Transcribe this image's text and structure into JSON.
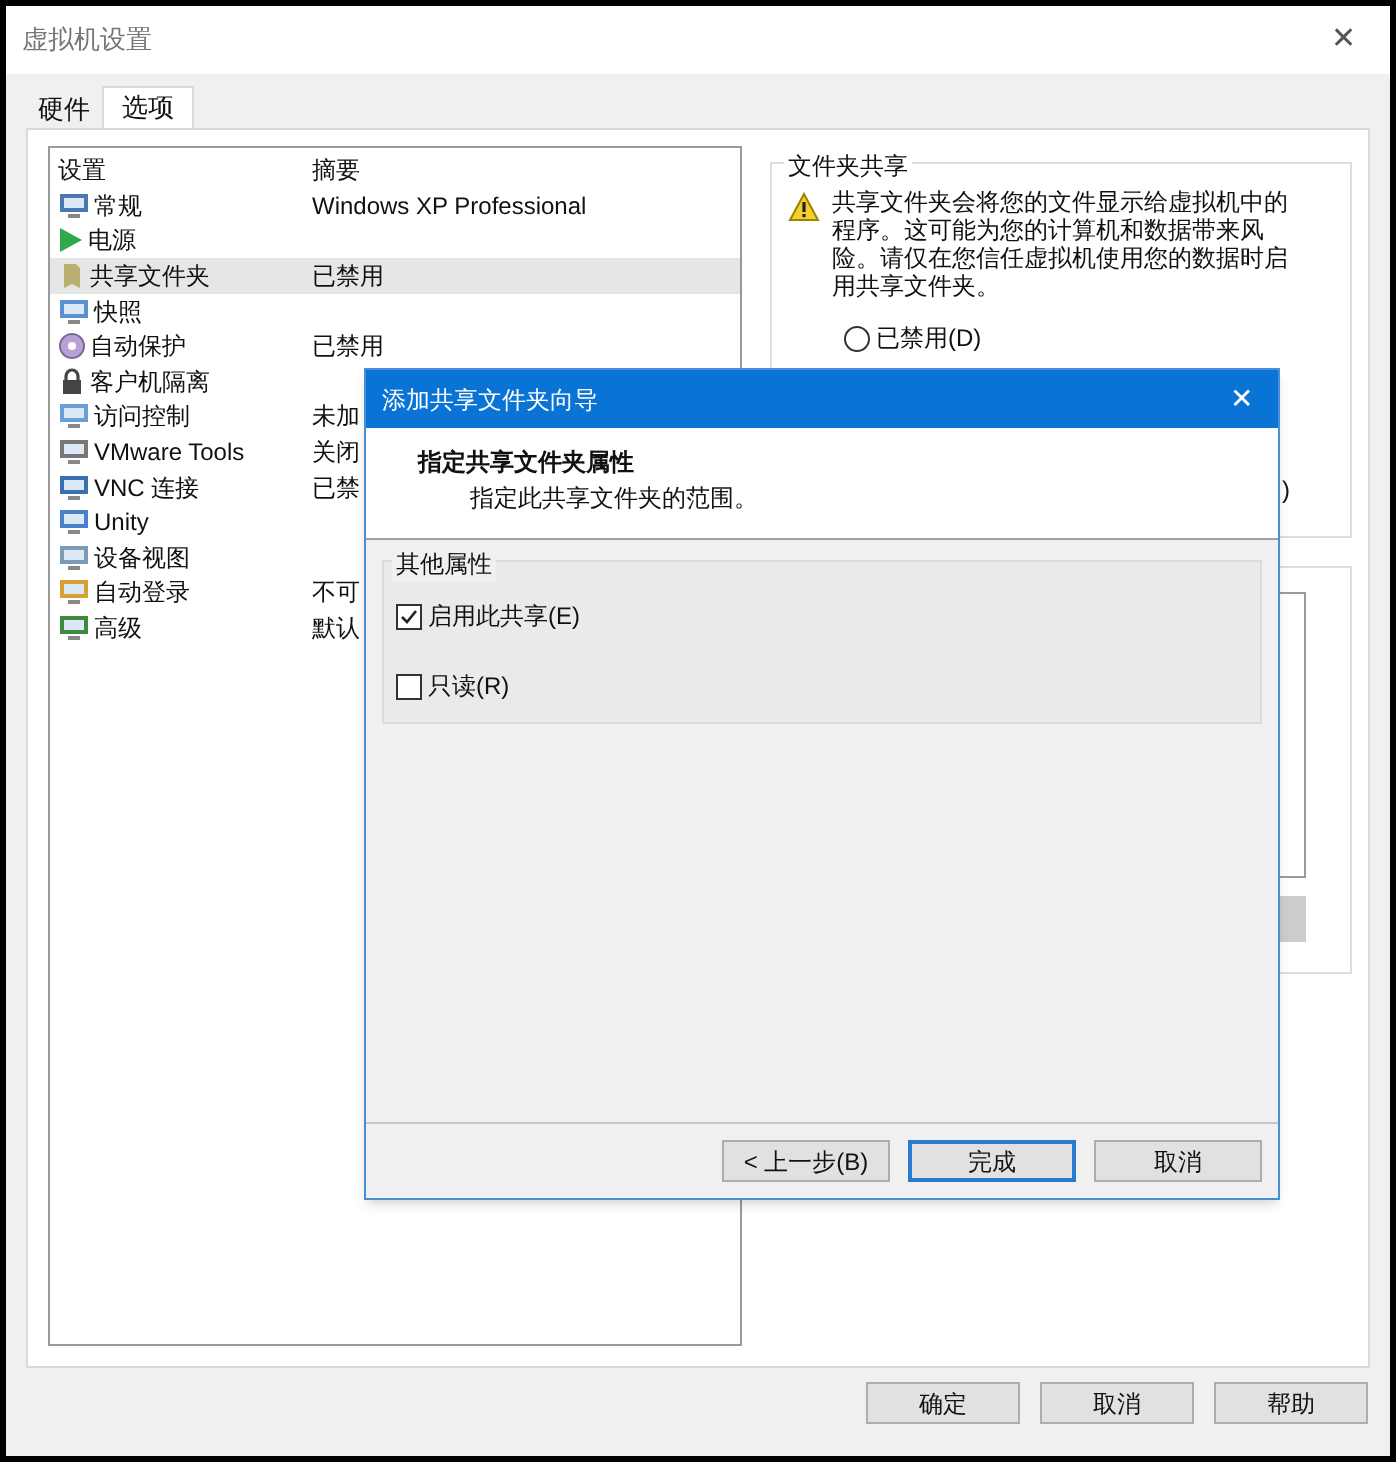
{
  "window": {
    "title": "虚拟机设置",
    "close": "✕"
  },
  "tabs": [
    {
      "label": "硬件",
      "selected": false
    },
    {
      "label": "选项",
      "selected": true
    }
  ],
  "settings_list": {
    "columns": [
      "设置",
      "摘要"
    ],
    "rows": [
      {
        "name": "常规",
        "summary": "Windows XP Professional",
        "selected": false
      },
      {
        "name": "电源",
        "summary": "",
        "selected": false
      },
      {
        "name": "共享文件夹",
        "summary": "已禁用",
        "selected": true
      },
      {
        "name": "快照",
        "summary": "",
        "selected": false
      },
      {
        "name": "自动保护",
        "summary": "已禁用",
        "selected": false
      },
      {
        "name": "客户机隔离",
        "summary": "",
        "selected": false
      },
      {
        "name": "访问控制",
        "summary": "未加",
        "selected": false
      },
      {
        "name": "VMware Tools",
        "summary": "关闭",
        "selected": false
      },
      {
        "name": "VNC 连接",
        "summary": "已禁",
        "selected": false
      },
      {
        "name": "Unity",
        "summary": "",
        "selected": false
      },
      {
        "name": "设备视图",
        "summary": "",
        "selected": false
      },
      {
        "name": "自动登录",
        "summary": "不可",
        "selected": false
      },
      {
        "name": "高级",
        "summary": "默认",
        "selected": false
      }
    ]
  },
  "folder_sharing": {
    "title": "文件夹共享",
    "warning": "共享文件夹会将您的文件显示给虚拟机中的程序。这可能为您的计算机和数据带来风险。请仅在您信任虚拟机使用您的数据时启用共享文件夹。",
    "radios": [
      {
        "label": "已禁用(D)",
        "selected": false
      }
    ],
    "covered_option_tail": ")"
  },
  "buttons": [
    "确定",
    "取消",
    "帮助"
  ],
  "dialog": {
    "title": "添加共享文件夹向导",
    "close": "✕",
    "heading": "指定共享文件夹属性",
    "subheading": "指定此共享文件夹的范围。",
    "group_title": "其他属性",
    "options": [
      {
        "label": "启用此共享(E)",
        "checked": true
      },
      {
        "label": "只读(R)",
        "checked": false
      }
    ],
    "buttons": [
      {
        "label": "< 上一步(B)",
        "default": false
      },
      {
        "label": "完成",
        "default": true
      },
      {
        "label": "取消",
        "default": false
      }
    ]
  }
}
